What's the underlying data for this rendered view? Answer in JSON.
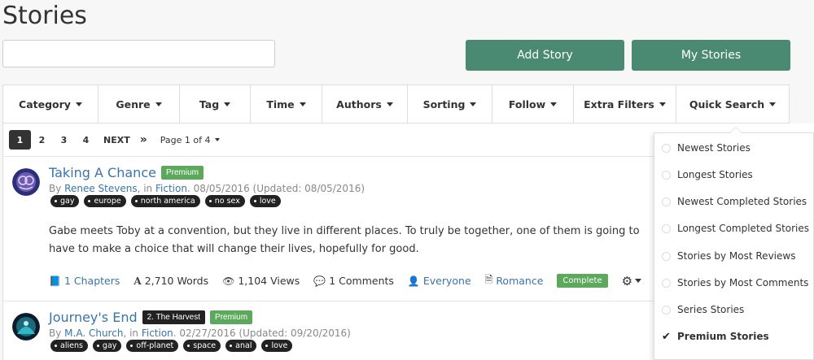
{
  "page": {
    "title": "Stories"
  },
  "search": {
    "placeholder": ""
  },
  "actions": {
    "add_story": "Add Story",
    "my_stories": "My Stories"
  },
  "filters": [
    {
      "label": "Category"
    },
    {
      "label": "Genre"
    },
    {
      "label": "Tag"
    },
    {
      "label": "Time"
    },
    {
      "label": "Authors"
    },
    {
      "label": "Sorting"
    },
    {
      "label": "Follow"
    },
    {
      "label": "Extra Filters"
    },
    {
      "label": "Quick Search"
    }
  ],
  "pagination": {
    "pages": [
      "1",
      "2",
      "3",
      "4"
    ],
    "active": "1",
    "next": "NEXT",
    "last": "»",
    "page_of": "Page 1 of 4"
  },
  "stories": [
    {
      "title": "Taking A Chance",
      "series": "",
      "badge": "Premium",
      "by": "By",
      "author": "Renee Stevens",
      "in": ", in",
      "category": "Fiction",
      "dates": ". 08/05/2016 (Updated: 08/05/2016)",
      "tags": [
        "gay",
        "europe",
        "north america",
        "no sex",
        "love"
      ],
      "summary": "Gabe meets Toby at a convention, but they live in different places. To truly be together, one of them is going to have to make a choice that will change their lives, hopefully for good.",
      "chapters": "1 Chapters",
      "words": "2,710 Words",
      "views": "1,104 Views",
      "comments": "1 Comments",
      "rating": "Everyone",
      "genre": "Romance",
      "status": "Complete"
    },
    {
      "title": "Journey's End",
      "series": "2. The Harvest",
      "badge": "Premium",
      "by": "By",
      "author": "M.A. Church",
      "in": ", in",
      "category": "Fiction",
      "dates": ". 02/27/2016 (Updated: 09/20/2016)",
      "tags": [
        "aliens",
        "gay",
        "off-planet",
        "space",
        "anal",
        "love"
      ]
    }
  ],
  "quick_search": {
    "items": [
      {
        "label": "Newest Stories",
        "selected": false
      },
      {
        "label": "Longest Stories",
        "selected": false
      },
      {
        "label": "Newest Completed Stories",
        "selected": false
      },
      {
        "label": "Longest Completed Stories",
        "selected": false
      },
      {
        "label": "Stories by Most Reviews",
        "selected": false
      },
      {
        "label": "Stories by Most Comments",
        "selected": false
      },
      {
        "label": "Series Stories",
        "selected": false
      },
      {
        "label": "Premium Stories",
        "selected": true
      }
    ]
  },
  "icons": {
    "chapters": "book-icon",
    "words": "font-icon",
    "views": "eye-icon",
    "comments": "comment-icon",
    "rating": "user-icon",
    "genre": "file-icon",
    "gear": "gear-icon",
    "check": "checkmark-icon"
  },
  "colors": {
    "accent_button": "#4a8a73",
    "link": "#3a74a8",
    "premium_badge": "#5ca85c",
    "tag_bg": "#222222"
  }
}
